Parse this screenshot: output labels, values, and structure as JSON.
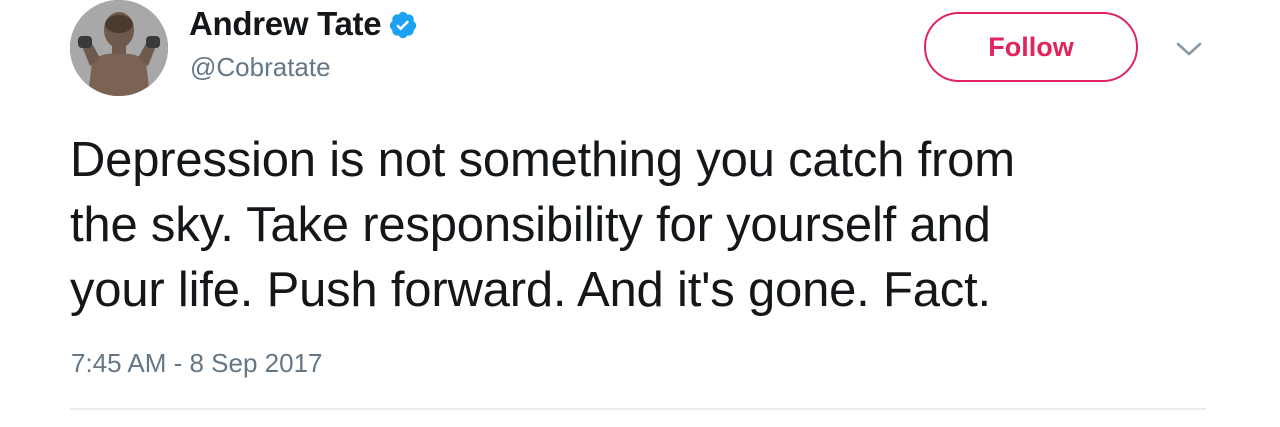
{
  "author": {
    "display_name": "Andrew Tate",
    "handle": "@Cobratate",
    "verified": true
  },
  "actions": {
    "follow_label": "Follow"
  },
  "tweet": {
    "lines": [
      "Depression is not something you catch from",
      "the sky. Take responsibility for yourself and",
      "your life. Push forward. And it's gone. Fact."
    ],
    "timestamp": "7:45 AM - 8 Sep 2017"
  },
  "colors": {
    "follow_accent": "#e0245e",
    "verified_badge": "#1da1f2",
    "secondary_text": "#657786",
    "primary_text": "#14171a",
    "divider": "#e6ecf0"
  },
  "icons": {
    "verified": "verified-badge-icon",
    "more": "chevron-down-icon"
  }
}
